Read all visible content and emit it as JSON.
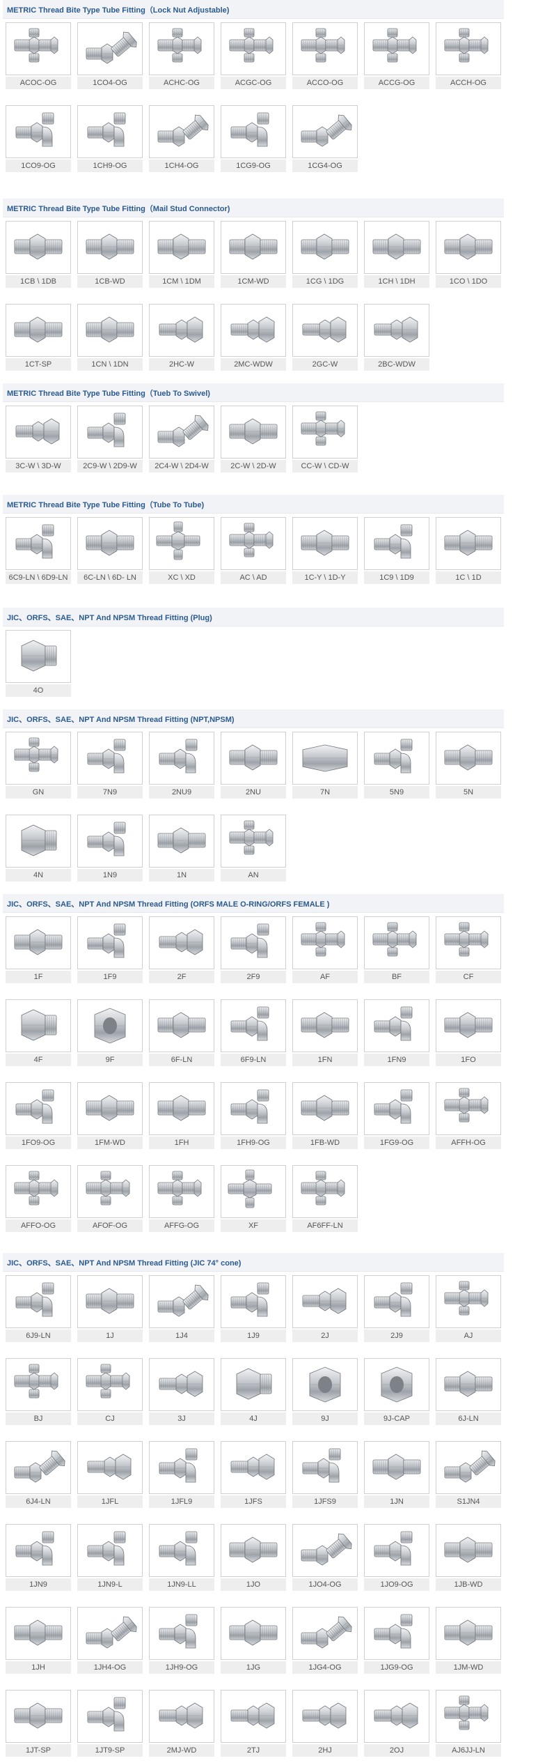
{
  "sections": [
    {
      "title": "METRIC Thread Bite Type Tube Fitting（Lock Nut Adjustable)",
      "items": [
        {
          "label": "ACOC-OG",
          "icon": "tee-fitting-icon"
        },
        {
          "label": "1CO4-OG",
          "icon": "elbow-45-fitting-icon"
        },
        {
          "label": "ACHC-OG",
          "icon": "tee-fitting-icon"
        },
        {
          "label": "ACGC-OG",
          "icon": "tee-fitting-icon"
        },
        {
          "label": "ACCO-OG",
          "icon": "tee-fitting-icon"
        },
        {
          "label": "ACCG-OG",
          "icon": "tee-fitting-icon"
        },
        {
          "label": "ACCH-OG",
          "icon": "tee-fitting-icon"
        },
        {
          "label": "1CO9-OG",
          "icon": "elbow-fitting-icon"
        },
        {
          "label": "1CH9-OG",
          "icon": "elbow-fitting-icon"
        },
        {
          "label": "1CH4-OG",
          "icon": "elbow-45-fitting-icon"
        },
        {
          "label": "1CG9-OG",
          "icon": "elbow-fitting-icon"
        },
        {
          "label": "1CG4-OG",
          "icon": "elbow-45-fitting-icon"
        }
      ]
    },
    {
      "title": "METRIC Thread Bite Type Tube Fitting（Mail Stud Connector)",
      "items": [
        {
          "label": "1CB \\ 1DB",
          "icon": "straight-connector-icon"
        },
        {
          "label": "1CB-WD",
          "icon": "straight-connector-icon"
        },
        {
          "label": "1CM \\ 1DM",
          "icon": "straight-connector-icon"
        },
        {
          "label": "1CM-WD",
          "icon": "straight-connector-icon"
        },
        {
          "label": "1CG \\ 1DG",
          "icon": "straight-connector-icon"
        },
        {
          "label": "1CH \\ 1DH",
          "icon": "straight-connector-icon"
        },
        {
          "label": "1CO \\ 1DO",
          "icon": "straight-connector-icon"
        },
        {
          "label": "1CT-SP",
          "icon": "straight-connector-icon"
        },
        {
          "label": "1CN \\ 1DN",
          "icon": "straight-connector-icon"
        },
        {
          "label": "2HC-W",
          "icon": "swivel-nut-icon"
        },
        {
          "label": "2MC-WDW",
          "icon": "swivel-nut-icon"
        },
        {
          "label": "2GC-W",
          "icon": "swivel-nut-icon"
        },
        {
          "label": "2BC-WDW",
          "icon": "swivel-nut-icon"
        }
      ]
    },
    {
      "title": "METRIC Thread Bite Type Tube Fitting（Tueb To Swivel)",
      "items": [
        {
          "label": "3C-W \\ 3D-W",
          "icon": "swivel-nut-icon"
        },
        {
          "label": "2C9-W \\ 2D9-W",
          "icon": "elbow-fitting-icon"
        },
        {
          "label": "2C4-W \\ 2D4-W",
          "icon": "elbow-45-fitting-icon"
        },
        {
          "label": "2C-W \\ 2D-W",
          "icon": "straight-connector-icon"
        },
        {
          "label": "CC-W \\ CD-W",
          "icon": "tee-fitting-icon"
        }
      ]
    },
    {
      "title": "METRIC Thread Bite Type Tube Fitting（Tube To Tube)",
      "items": [
        {
          "label": "6C9-LN \\ 6D9-LN",
          "icon": "elbow-fitting-icon"
        },
        {
          "label": "6C-LN \\ 6D- LN",
          "icon": "straight-connector-icon"
        },
        {
          "label": "XC \\ XD",
          "icon": "cross-fitting-icon"
        },
        {
          "label": "AC \\ AD",
          "icon": "tee-fitting-icon"
        },
        {
          "label": "1C-Y \\ 1D-Y",
          "icon": "straight-connector-icon"
        },
        {
          "label": "1C9 \\ 1D9",
          "icon": "elbow-fitting-icon"
        },
        {
          "label": "1C \\ 1D",
          "icon": "straight-connector-icon"
        }
      ]
    },
    {
      "title": "JIC、ORFS、SAE、NPT And NPSM Thread Fitting (Plug)",
      "items": [
        {
          "label": "4O",
          "icon": "plug-icon"
        }
      ]
    },
    {
      "title": "JIC、ORFS、SAE、NPT And NPSM Thread Fitting (NPT,NPSM)",
      "items": [
        {
          "label": "GN",
          "icon": "tee-fitting-icon"
        },
        {
          "label": "7N9",
          "icon": "elbow-fitting-icon"
        },
        {
          "label": "2NU9",
          "icon": "elbow-fitting-icon"
        },
        {
          "label": "2NU",
          "icon": "straight-connector-icon"
        },
        {
          "label": "7N",
          "icon": "hex-coupling-icon"
        },
        {
          "label": "5N9",
          "icon": "elbow-fitting-icon"
        },
        {
          "label": "5N",
          "icon": "straight-connector-icon"
        },
        {
          "label": "4N",
          "icon": "plug-icon"
        },
        {
          "label": "1N9",
          "icon": "elbow-fitting-icon"
        },
        {
          "label": "1N",
          "icon": "straight-connector-icon"
        },
        {
          "label": "AN",
          "icon": "tee-fitting-icon"
        }
      ]
    },
    {
      "title": "JIC、ORFS、SAE、NPT And NPSM Thread Fitting (ORFS MALE O-RING/ORFS FEMALE )",
      "items": [
        {
          "label": "1F",
          "icon": "straight-connector-icon"
        },
        {
          "label": "1F9",
          "icon": "elbow-fitting-icon"
        },
        {
          "label": "2F",
          "icon": "swivel-nut-icon"
        },
        {
          "label": "2F9",
          "icon": "elbow-fitting-icon"
        },
        {
          "label": "AF",
          "icon": "tee-fitting-icon"
        },
        {
          "label": "BF",
          "icon": "tee-fitting-icon"
        },
        {
          "label": "CF",
          "icon": "tee-fitting-icon"
        },
        {
          "label": "4F",
          "icon": "plug-icon"
        },
        {
          "label": "9F",
          "icon": "hex-cap-icon"
        },
        {
          "label": "6F-LN",
          "icon": "straight-connector-icon"
        },
        {
          "label": "6F9-LN",
          "icon": "elbow-fitting-icon"
        },
        {
          "label": "1FN",
          "icon": "straight-connector-icon"
        },
        {
          "label": "1FN9",
          "icon": "elbow-fitting-icon"
        },
        {
          "label": "1FO",
          "icon": "straight-connector-icon"
        },
        {
          "label": "1FO9-OG",
          "icon": "elbow-fitting-icon"
        },
        {
          "label": "1FM-WD",
          "icon": "straight-connector-icon"
        },
        {
          "label": "1FH",
          "icon": "straight-connector-icon"
        },
        {
          "label": "1FH9-OG",
          "icon": "elbow-fitting-icon"
        },
        {
          "label": "1FB-WD",
          "icon": "straight-connector-icon"
        },
        {
          "label": "1FG9-OG",
          "icon": "elbow-fitting-icon"
        },
        {
          "label": "AFFH-OG",
          "icon": "tee-fitting-icon"
        },
        {
          "label": "AFFO-OG",
          "icon": "tee-fitting-icon"
        },
        {
          "label": "AFOF-OG",
          "icon": "tee-fitting-icon"
        },
        {
          "label": "AFFG-OG",
          "icon": "tee-fitting-icon"
        },
        {
          "label": "XF",
          "icon": "cross-fitting-icon"
        },
        {
          "label": "AF6FF-LN",
          "icon": "tee-fitting-icon"
        }
      ]
    },
    {
      "title": "JIC、ORFS、SAE、NPT And NPSM Thread Fitting (JIC 74° cone)",
      "items": [
        {
          "label": "6J9-LN",
          "icon": "elbow-fitting-icon"
        },
        {
          "label": "1J",
          "icon": "straight-connector-icon"
        },
        {
          "label": "1J4",
          "icon": "elbow-45-fitting-icon"
        },
        {
          "label": "1J9",
          "icon": "elbow-fitting-icon"
        },
        {
          "label": "2J",
          "icon": "swivel-nut-icon"
        },
        {
          "label": "2J9",
          "icon": "elbow-fitting-icon"
        },
        {
          "label": "AJ",
          "icon": "tee-fitting-icon"
        },
        {
          "label": "BJ",
          "icon": "tee-fitting-icon"
        },
        {
          "label": "CJ",
          "icon": "tee-fitting-icon"
        },
        {
          "label": "3J",
          "icon": "swivel-nut-icon"
        },
        {
          "label": "4J",
          "icon": "plug-icon"
        },
        {
          "label": "9J",
          "icon": "hex-cap-icon"
        },
        {
          "label": "9J-CAP",
          "icon": "hex-cap-icon"
        },
        {
          "label": "6J-LN",
          "icon": "straight-connector-icon"
        },
        {
          "label": "6J4-LN",
          "icon": "elbow-45-fitting-icon"
        },
        {
          "label": "1JFL",
          "icon": "swivel-nut-icon"
        },
        {
          "label": "1JFL9",
          "icon": "elbow-fitting-icon"
        },
        {
          "label": "1JFS",
          "icon": "swivel-nut-icon"
        },
        {
          "label": "1JFS9",
          "icon": "elbow-fitting-icon"
        },
        {
          "label": "1JN",
          "icon": "straight-connector-icon"
        },
        {
          "label": "S1JN4",
          "icon": "elbow-45-fitting-icon"
        },
        {
          "label": "1JN9",
          "icon": "elbow-fitting-icon"
        },
        {
          "label": "1JN9-L",
          "icon": "elbow-fitting-icon"
        },
        {
          "label": "1JN9-LL",
          "icon": "elbow-fitting-icon"
        },
        {
          "label": "1JO",
          "icon": "straight-connector-icon"
        },
        {
          "label": "1JO4-OG",
          "icon": "elbow-45-fitting-icon"
        },
        {
          "label": "1JO9-OG",
          "icon": "elbow-fitting-icon"
        },
        {
          "label": "1JB-WD",
          "icon": "straight-connector-icon"
        },
        {
          "label": "1JH",
          "icon": "straight-connector-icon"
        },
        {
          "label": "1JH4-OG",
          "icon": "elbow-45-fitting-icon"
        },
        {
          "label": "1JH9-OG",
          "icon": "elbow-fitting-icon"
        },
        {
          "label": "1JG",
          "icon": "straight-connector-icon"
        },
        {
          "label": "1JG4-OG",
          "icon": "elbow-45-fitting-icon"
        },
        {
          "label": "1JG9-OG",
          "icon": "elbow-fitting-icon"
        },
        {
          "label": "1JM-WD",
          "icon": "straight-connector-icon"
        },
        {
          "label": "1JT-SP",
          "icon": "straight-connector-icon"
        },
        {
          "label": "1JT9-SP",
          "icon": "elbow-fitting-icon"
        },
        {
          "label": "2MJ-WD",
          "icon": "swivel-nut-icon"
        },
        {
          "label": "2TJ",
          "icon": "swivel-nut-icon"
        },
        {
          "label": "2HJ",
          "icon": "swivel-nut-icon"
        },
        {
          "label": "2OJ",
          "icon": "swivel-nut-icon"
        },
        {
          "label": "AJ6JJ-LN",
          "icon": "tee-fitting-icon"
        }
      ]
    }
  ]
}
